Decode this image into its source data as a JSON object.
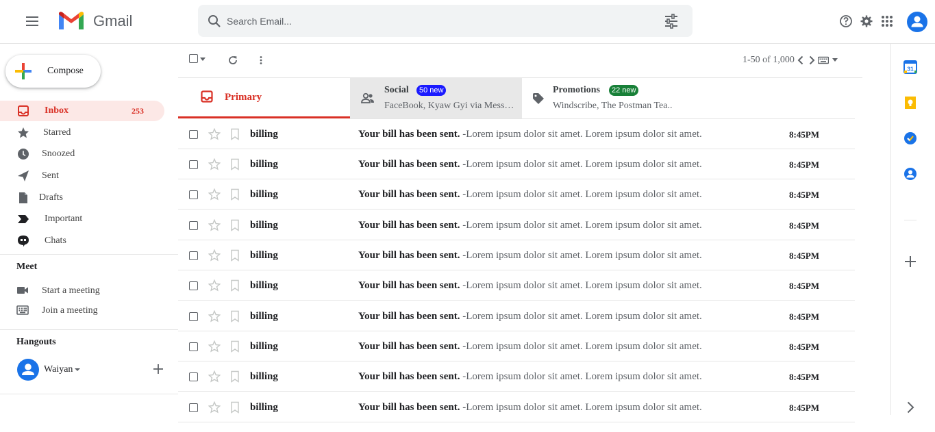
{
  "header": {
    "app_name": "Gmail",
    "search_placeholder": "Search Email..."
  },
  "sidebar": {
    "compose_label": "Compose",
    "nav": [
      {
        "label": "Inbox",
        "count": "253",
        "icon": "inbox-icon",
        "active": true
      },
      {
        "label": "Starred",
        "icon": "star-icon"
      },
      {
        "label": "Snoozed",
        "icon": "clock-icon"
      },
      {
        "label": "Sent",
        "icon": "send-icon"
      },
      {
        "label": "Drafts",
        "icon": "file-icon"
      },
      {
        "label": "Important",
        "icon": "label-important-icon"
      },
      {
        "label": "Chats",
        "icon": "chat-icon"
      }
    ],
    "meet": {
      "title": "Meet",
      "items": [
        {
          "label": "Start a meeting",
          "icon": "videocam-icon"
        },
        {
          "label": "Join a meeting",
          "icon": "keyboard-icon"
        }
      ]
    },
    "hangouts": {
      "title": "Hangouts",
      "user": "Waiyan"
    }
  },
  "toolbar": {
    "pagination": "1-50 of 1,000"
  },
  "tabs": [
    {
      "title": "Primary",
      "icon": "inbox-icon",
      "active": true,
      "color": "#d93025"
    },
    {
      "title": "Social",
      "badge": "50 new",
      "badge_color": "#1a1aff",
      "subtitle": "FaceBook, Kyaw Gyi via Messenger",
      "icon": "people-icon"
    },
    {
      "title": "Promotions",
      "badge": "22 new",
      "badge_color": "#188038",
      "subtitle": "Windscribe, The Postman Tea..",
      "icon": "tag-icon"
    }
  ],
  "emails": [
    {
      "sender": "billing",
      "subject": "Your bill has been sent.",
      "snippet": "-Lorem ipsum dolor sit amet. Lorem ipsum dolor sit amet.",
      "time": "8:45PM"
    },
    {
      "sender": "billing",
      "subject": "Your bill has been sent.",
      "snippet": "-Lorem ipsum dolor sit amet. Lorem ipsum dolor sit amet.",
      "time": "8:45PM"
    },
    {
      "sender": "billing",
      "subject": "Your bill has been sent.",
      "snippet": "-Lorem ipsum dolor sit amet. Lorem ipsum dolor sit amet.",
      "time": "8:45PM"
    },
    {
      "sender": "billing",
      "subject": "Your bill has been sent.",
      "snippet": "-Lorem ipsum dolor sit amet. Lorem ipsum dolor sit amet.",
      "time": "8:45PM"
    },
    {
      "sender": "billing",
      "subject": "Your bill has been sent.",
      "snippet": "-Lorem ipsum dolor sit amet. Lorem ipsum dolor sit amet.",
      "time": "8:45PM"
    },
    {
      "sender": "billing",
      "subject": "Your bill has been sent.",
      "snippet": "-Lorem ipsum dolor sit amet. Lorem ipsum dolor sit amet.",
      "time": "8:45PM"
    },
    {
      "sender": "billing",
      "subject": "Your bill has been sent.",
      "snippet": "-Lorem ipsum dolor sit amet. Lorem ipsum dolor sit amet.",
      "time": "8:45PM"
    },
    {
      "sender": "billing",
      "subject": "Your bill has been sent.",
      "snippet": "-Lorem ipsum dolor sit amet. Lorem ipsum dolor sit amet.",
      "time": "8:45PM"
    },
    {
      "sender": "billing",
      "subject": "Your bill has been sent.",
      "snippet": "-Lorem ipsum dolor sit amet. Lorem ipsum dolor sit amet.",
      "time": "8:45PM"
    },
    {
      "sender": "billing",
      "subject": "Your bill has been sent.",
      "snippet": "-Lorem ipsum dolor sit amet. Lorem ipsum dolor sit amet.",
      "time": "8:45PM"
    }
  ],
  "right_panel": {
    "apps": [
      {
        "icon": "calendar-icon",
        "text": "31"
      },
      {
        "icon": "keep-icon"
      },
      {
        "icon": "tasks-icon"
      },
      {
        "icon": "contacts-icon"
      }
    ]
  },
  "colors": {
    "accent_red": "#d93025",
    "inbox_active_bg": "#fce8e6",
    "blue": "#1a73e8",
    "social_badge": "#1a1aff",
    "promo_badge": "#188038"
  }
}
